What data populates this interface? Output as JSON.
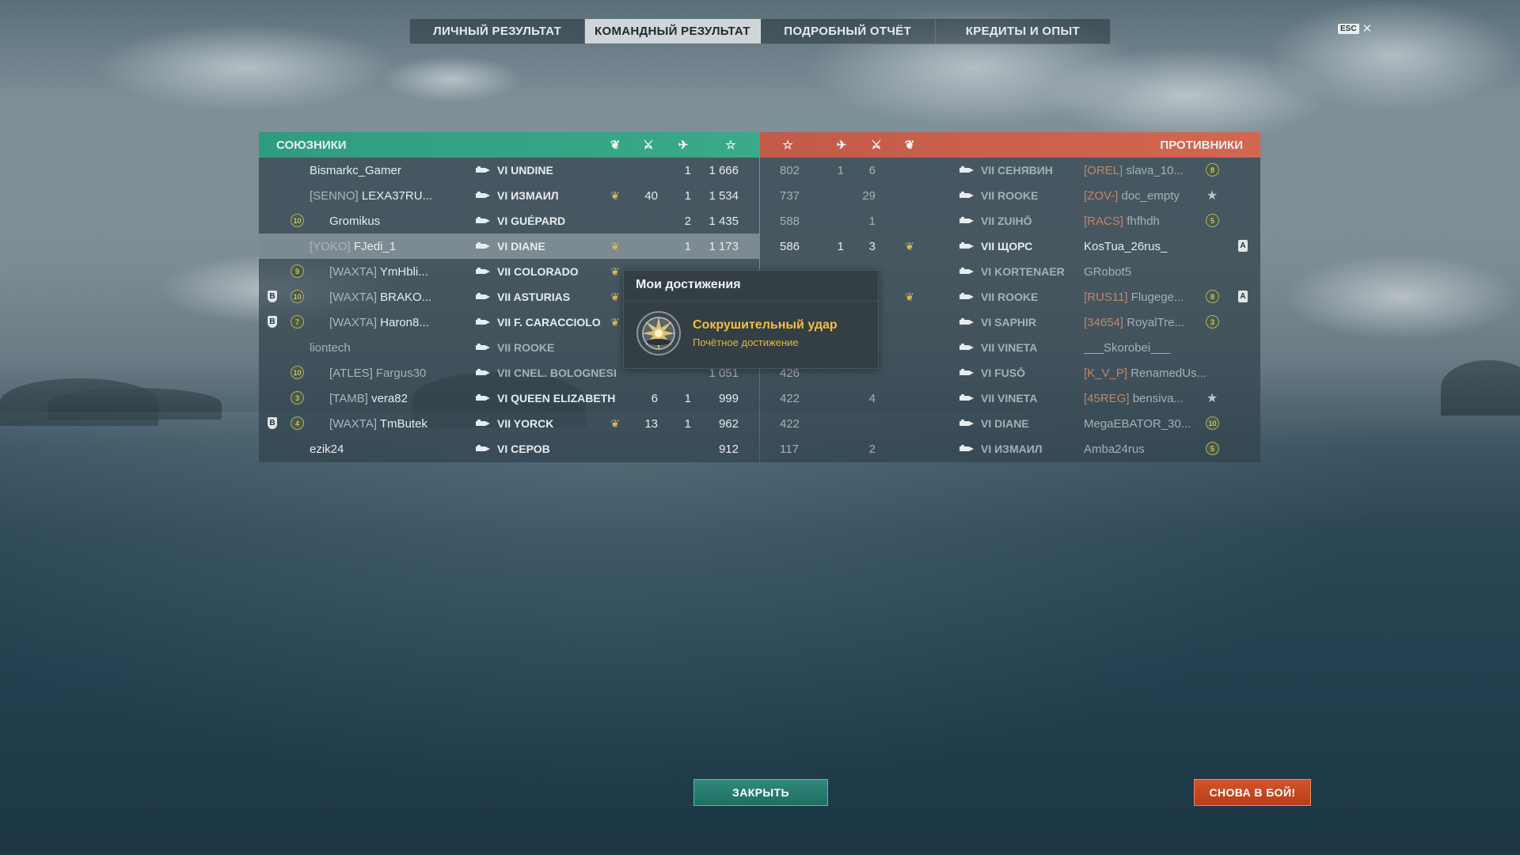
{
  "tabs": [
    {
      "label": "ЛИЧНЫЙ РЕЗУЛЬТАТ",
      "active": false
    },
    {
      "label": "КОМАНДНЫЙ РЕЗУЛЬТАТ",
      "active": true
    },
    {
      "label": "ПОДРОБНЫЙ ОТЧЁТ",
      "active": false
    },
    {
      "label": "КРЕДИТЫ И ОПЫТ",
      "active": false
    }
  ],
  "esc": {
    "key": "ESC",
    "close": "✕"
  },
  "allies": {
    "title": "СОЮЗНИКИ",
    "header_icons": [
      "laurel-icon",
      "crossed-swords-icon",
      "plane-icon",
      "star-icon"
    ],
    "rows": [
      {
        "clan": "",
        "name": "Bismarkc_Gamer",
        "ship": "VI UNDINE",
        "medal": false,
        "kills": "",
        "planes": "1",
        "xp": "1 666",
        "badge": "",
        "shield": "",
        "dim": false
      },
      {
        "clan": "[SENNO]",
        "name": "LEXA37RU...",
        "ship": "VI ИЗМАИЛ",
        "medal": true,
        "kills": "40",
        "planes": "1",
        "xp": "1 534",
        "badge": "",
        "shield": "",
        "dim": false
      },
      {
        "clan": "",
        "name": "Gromikus",
        "ship": "VI GUÉPARD",
        "medal": false,
        "kills": "",
        "planes": "2",
        "xp": "1 435",
        "badge": "10",
        "shield": "",
        "dim": false
      },
      {
        "clan": "[YOKO]",
        "name": "FJedi_1",
        "ship": "VI DIANE",
        "medal": true,
        "kills": "",
        "planes": "1",
        "xp": "1 173",
        "badge": "",
        "shield": "",
        "dim": false,
        "highlight": true
      },
      {
        "clan": "[WAXTA]",
        "name": "YmHbli...",
        "ship": "VII COLORADO",
        "medal": true,
        "kills": "",
        "planes": "",
        "xp": "",
        "badge": "9",
        "shield": "",
        "dim": false
      },
      {
        "clan": "[WAXTA]",
        "name": "BRAKO...",
        "ship": "VII ASTURIAS",
        "medal": true,
        "kills": "",
        "planes": "",
        "xp": "",
        "badge": "10",
        "shield": "B",
        "dim": false
      },
      {
        "clan": "[WAXTA]",
        "name": "Haron8...",
        "ship": "VII F. CARACCIOLO",
        "medal": true,
        "kills": "",
        "planes": "",
        "xp": "",
        "badge": "7",
        "shield": "B",
        "dim": false
      },
      {
        "clan": "",
        "name": "liontech",
        "ship": "VII ROOKE",
        "medal": false,
        "kills": "",
        "planes": "",
        "xp": "",
        "badge": "",
        "shield": "",
        "dim": true
      },
      {
        "clan": "[ATLES]",
        "name": "Fargus30",
        "ship": "VII CNEL. BOLOGNESI",
        "medal": false,
        "kills": "",
        "planes": "",
        "xp": "1 051",
        "badge": "10",
        "shield": "",
        "dim": true
      },
      {
        "clan": "[TAMB]",
        "name": "vera82",
        "ship": "VI QUEEN ELIZABETH",
        "medal": false,
        "kills": "6",
        "planes": "1",
        "xp": "999",
        "badge": "3",
        "shield": "",
        "dim": false
      },
      {
        "clan": "[WAXTA]",
        "name": "TmButek",
        "ship": "VII YORCK",
        "medal": true,
        "kills": "13",
        "planes": "1",
        "xp": "962",
        "badge": "4",
        "shield": "B",
        "dim": false
      },
      {
        "clan": "",
        "name": "ezik24",
        "ship": "VI СЕРОВ",
        "medal": false,
        "kills": "",
        "planes": "",
        "xp": "912",
        "badge": "",
        "shield": "",
        "dim": false
      }
    ]
  },
  "enemies": {
    "title": "ПРОТИВНИКИ",
    "header_icons": [
      "star-icon",
      "plane-icon",
      "crossed-swords-icon",
      "laurel-icon"
    ],
    "rows": [
      {
        "xp": "802",
        "planes": "1",
        "kills": "6",
        "medal": false,
        "ship": "VII СЕНЯВИН",
        "clan": "[OREL]",
        "name": "slava_10...",
        "badge": "8",
        "mark": "",
        "dim": true
      },
      {
        "xp": "737",
        "planes": "",
        "kills": "29",
        "medal": false,
        "ship": "VII ROOKE",
        "clan": "[ZOV-]",
        "name": "doc_empty",
        "badge": "★",
        "mark": "",
        "dim": true
      },
      {
        "xp": "588",
        "planes": "",
        "kills": "1",
        "medal": false,
        "ship": "VII ZUIHŌ",
        "clan": "[RACS]",
        "name": "fhfhdh",
        "badge": "5",
        "mark": "",
        "dim": true
      },
      {
        "xp": "586",
        "planes": "1",
        "kills": "3",
        "medal": true,
        "ship": "VII ЩОРС",
        "clan": "",
        "name": "KosTua_26rus_",
        "badge": "",
        "mark": "A",
        "dim": false
      },
      {
        "xp": "",
        "planes": "",
        "kills": "",
        "medal": false,
        "ship": "VI KORTENAER",
        "clan": "",
        "name": "GRobot5",
        "badge": "",
        "mark": "",
        "dim": true
      },
      {
        "xp": "",
        "planes": "",
        "kills": "",
        "medal": true,
        "ship": "VII ROOKE",
        "clan": "[RUS11]",
        "name": "Flugege...",
        "badge": "8",
        "mark": "A",
        "dim": true
      },
      {
        "xp": "",
        "planes": "",
        "kills": "",
        "medal": false,
        "ship": "VI SAPHIR",
        "clan": "[34654]",
        "name": "RoyalTre...",
        "badge": "3",
        "mark": "",
        "dim": true
      },
      {
        "xp": "",
        "planes": "",
        "kills": "",
        "medal": false,
        "ship": "VII VINETA",
        "clan": "",
        "name": "___Skorobei___",
        "badge": "",
        "mark": "",
        "dim": true
      },
      {
        "xp": "426",
        "planes": "",
        "kills": "",
        "medal": false,
        "ship": "VI FUSŌ",
        "clan": "[K_V_P]",
        "name": "RenamedUs...",
        "badge": "",
        "mark": "",
        "dim": true
      },
      {
        "xp": "422",
        "planes": "",
        "kills": "4",
        "medal": false,
        "ship": "VII VINETA",
        "clan": "[45REG]",
        "name": "bensiva...",
        "badge": "★",
        "mark": "",
        "dim": true
      },
      {
        "xp": "422",
        "planes": "",
        "kills": "",
        "medal": false,
        "ship": "VI DIANE",
        "clan": "",
        "name": "MegaEBATOR_30...",
        "badge": "10",
        "mark": "",
        "dim": true
      },
      {
        "xp": "117",
        "planes": "",
        "kills": "2",
        "medal": false,
        "ship": "VI ИЗМАИЛ",
        "clan": "",
        "name": "Amba24rus",
        "badge": "5",
        "mark": "",
        "dim": true
      }
    ]
  },
  "tooltip": {
    "title": "Мои достижения",
    "achievement_name": "Сокрушительный удар",
    "achievement_type": "Почётное достижение",
    "icon": "achievement-medal-icon"
  },
  "buttons": {
    "close": "ЗАКРЫТЬ",
    "battle_again": "СНОВА В БОЙ!"
  },
  "colors": {
    "allies_header": "#3aaa88",
    "enemies_header": "#d36650",
    "medal": "#d8b850",
    "tooltip_title": "#f0c040",
    "close_button": "#2f8a7c",
    "battle_button": "#d4532a"
  }
}
